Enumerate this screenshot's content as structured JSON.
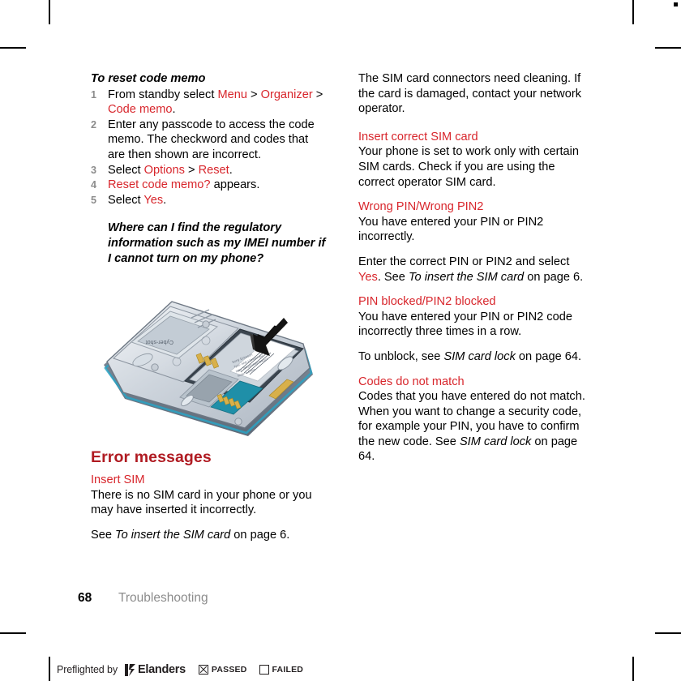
{
  "document": {
    "folio": "68",
    "chapter": "Troubleshooting"
  },
  "colors": {
    "accent_red": "#d8262c",
    "heading_red": "#b01b22",
    "folio_gray": "#8c8c8c"
  },
  "left_column": {
    "procedure": {
      "heading": "To reset code memo",
      "steps": [
        {
          "number": "1",
          "parts": [
            {
              "text": "From standby select ",
              "style": "normal"
            },
            {
              "text": "Menu",
              "style": "red"
            },
            {
              "text": " > ",
              "style": "normal"
            },
            {
              "text": "Organizer",
              "style": "red"
            },
            {
              "text": " > ",
              "style": "normal"
            },
            {
              "text": "Code memo",
              "style": "red"
            },
            {
              "text": ".",
              "style": "normal"
            }
          ]
        },
        {
          "number": "2",
          "parts": [
            {
              "text": "Enter any passcode to access the code memo. The checkword and codes that are then shown are incorrect.",
              "style": "normal"
            }
          ]
        },
        {
          "number": "3",
          "parts": [
            {
              "text": "Select ",
              "style": "normal"
            },
            {
              "text": "Options",
              "style": "red"
            },
            {
              "text": " > ",
              "style": "normal"
            },
            {
              "text": "Reset",
              "style": "red"
            },
            {
              "text": ".",
              "style": "normal"
            }
          ]
        },
        {
          "number": "4",
          "parts": [
            {
              "text": "Reset code memo?",
              "style": "red"
            },
            {
              "text": " appears.",
              "style": "normal"
            }
          ]
        },
        {
          "number": "5",
          "parts": [
            {
              "text": "Select ",
              "style": "normal"
            },
            {
              "text": "Yes",
              "style": "red"
            },
            {
              "text": ".",
              "style": "normal"
            }
          ]
        }
      ]
    },
    "faq_question": "Where can I find the regulatory information such as my IMEI number if I cannot turn on my phone?",
    "illustration": {
      "name": "phone-back-cover-removed-with-label-arrow",
      "label_lines": [
        "Sony Ericsson",
        "Type: XX",
        "IMEI: XXXXXXXXXXXXXXX",
        "Made in China"
      ]
    },
    "error_section": {
      "title": "Error messages",
      "entries": [
        {
          "label_parts": [
            {
              "text": "Insert SIM",
              "style": "red"
            }
          ],
          "body_paragraphs": [
            [
              {
                "text": "There is no SIM card in your phone or you may have inserted it incorrectly.",
                "style": "normal"
              }
            ],
            [
              {
                "text": "See ",
                "style": "normal"
              },
              {
                "text": "To insert the SIM card",
                "style": "italic"
              },
              {
                "text": " on page 6.",
                "style": "normal"
              }
            ]
          ]
        }
      ]
    }
  },
  "right_column": {
    "continuation_paragraph": [
      {
        "text": "The SIM card connectors need cleaning. If the card is damaged, contact your network operator.",
        "style": "normal"
      }
    ],
    "entries": [
      {
        "label_parts": [
          {
            "text": "Insert correct SIM card",
            "style": "red"
          }
        ],
        "body_paragraphs": [
          [
            {
              "text": "Your phone is set to work only with certain SIM cards. Check if you are using the correct operator SIM card.",
              "style": "normal"
            }
          ]
        ]
      },
      {
        "label_parts": [
          {
            "text": "Wrong PIN",
            "style": "red"
          },
          {
            "text": "/",
            "style": "normal"
          },
          {
            "text": "Wrong PIN2",
            "style": "red"
          }
        ],
        "body_paragraphs": [
          [
            {
              "text": "You have entered your PIN or PIN2 incorrectly.",
              "style": "normal"
            }
          ],
          [
            {
              "text": "Enter the correct PIN or PIN2 and select ",
              "style": "normal"
            },
            {
              "text": "Yes",
              "style": "red"
            },
            {
              "text": ". See ",
              "style": "normal"
            },
            {
              "text": "To insert the SIM card",
              "style": "italic"
            },
            {
              "text": " on page 6.",
              "style": "normal"
            }
          ]
        ]
      },
      {
        "label_parts": [
          {
            "text": "PIN blocked",
            "style": "red"
          },
          {
            "text": "/",
            "style": "normal"
          },
          {
            "text": "PIN2 blocked",
            "style": "red"
          }
        ],
        "body_paragraphs": [
          [
            {
              "text": "You have entered your PIN or PIN2 code incorrectly three times in a row.",
              "style": "normal"
            }
          ],
          [
            {
              "text": "To unblock, see ",
              "style": "normal"
            },
            {
              "text": "SIM card lock",
              "style": "italic"
            },
            {
              "text": " on page 64.",
              "style": "normal"
            }
          ]
        ]
      },
      {
        "label_parts": [
          {
            "text": "Codes do not match",
            "style": "red"
          }
        ],
        "body_paragraphs": [
          [
            {
              "text": "Codes that you have entered do not match. When you want to change a security code, for example your PIN, you have to confirm the new code. See ",
              "style": "normal"
            },
            {
              "text": "SIM card lock",
              "style": "italic"
            },
            {
              "text": " on page 64.",
              "style": "normal"
            }
          ]
        ]
      }
    ]
  },
  "preflight": {
    "text": "Preflighted by",
    "brand": "Elanders",
    "passed_label": "PASSED",
    "failed_label": "FAILED",
    "passed_checked": true,
    "failed_checked": false
  }
}
